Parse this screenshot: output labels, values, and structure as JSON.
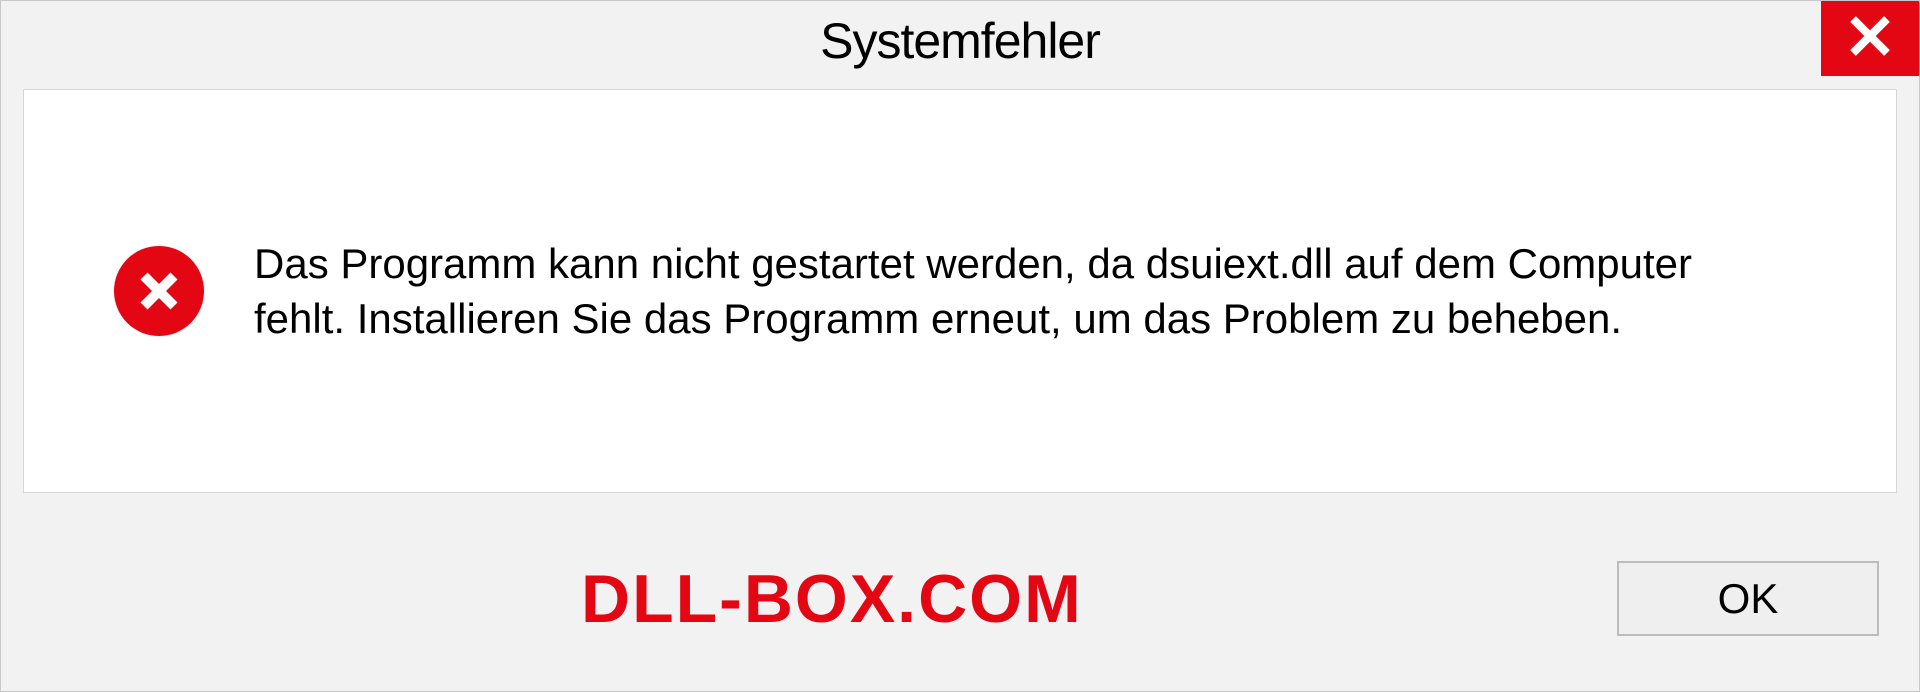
{
  "dialog": {
    "title": "Systemfehler",
    "message": "Das Programm kann nicht gestartet werden, da dsuiext.dll auf dem Computer fehlt. Installieren Sie das Programm erneut, um das Problem zu beheben.",
    "ok_label": "OK"
  },
  "watermark": "DLL-BOX.COM"
}
